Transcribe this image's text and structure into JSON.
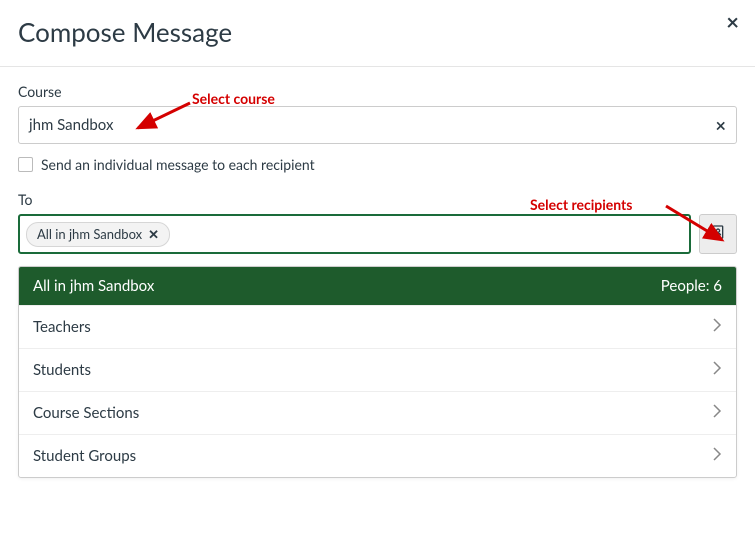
{
  "dialog": {
    "title": "Compose Message"
  },
  "course": {
    "label": "Course",
    "value": "jhm Sandbox"
  },
  "individual": {
    "label": "Send an individual message to each recipient"
  },
  "to": {
    "label": "To",
    "chip": "All in jhm Sandbox"
  },
  "recipients": {
    "header": "All in jhm Sandbox",
    "people_label": "People: 6",
    "items": [
      "Teachers",
      "Students",
      "Course Sections",
      "Student Groups"
    ]
  },
  "annotations": {
    "select_course": "Select course",
    "select_recipients": "Select recipients"
  }
}
